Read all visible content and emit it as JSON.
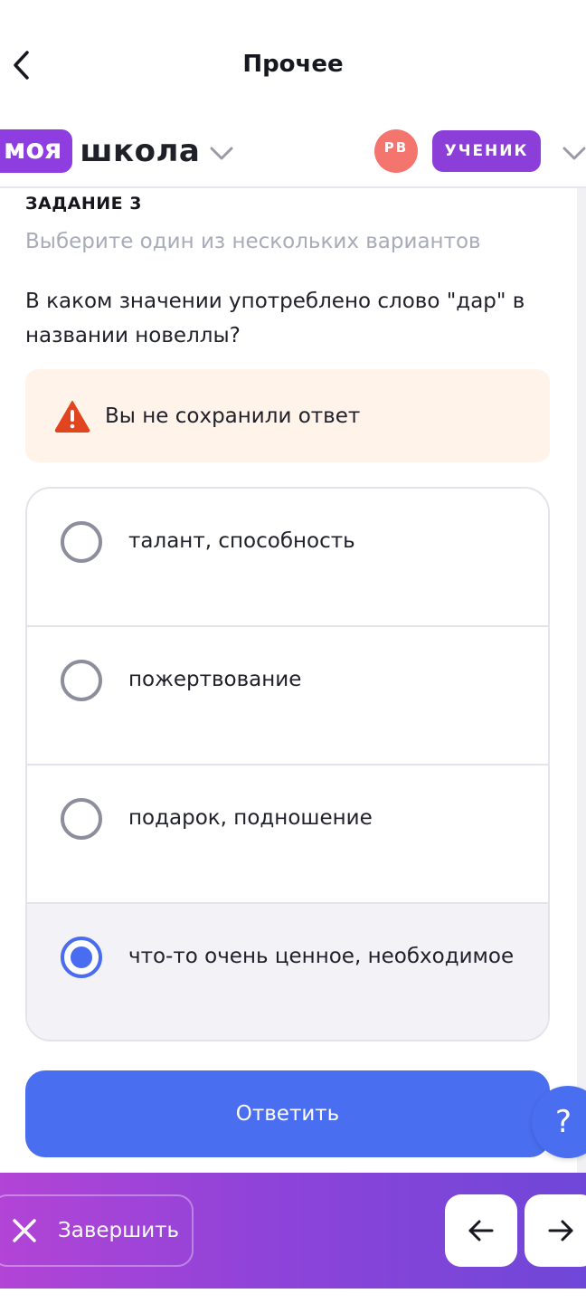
{
  "header": {
    "title": "Прочее",
    "back_icon": "chevron-left-icon"
  },
  "school_bar": {
    "logo_part1": "моя",
    "logo_part2": "школа",
    "avatar_initials": "РВ",
    "role": "УЧЕНИК",
    "colors": {
      "brand": "#8e3ee0",
      "avatar": "#f4746e"
    }
  },
  "task": {
    "label": "ЗАДАНИЕ 3",
    "hint": "Выберите один из нескольких вариантов",
    "question": "В каком значении употреблено слово \"дар\" в названии новеллы?",
    "warning": "Вы не сохранили ответ",
    "options": [
      {
        "text": "талант, способность",
        "selected": false
      },
      {
        "text": "пожертвование",
        "selected": false
      },
      {
        "text": "подарок, подношение",
        "selected": false
      },
      {
        "text": "что-то очень ценное, необходимое",
        "selected": true
      }
    ],
    "submit_label": "Ответить",
    "help_label": "?"
  },
  "bottom_bar": {
    "finish_label": "Завершить",
    "prev_icon": "arrow-left-icon",
    "next_icon": "arrow-right-icon"
  },
  "colors": {
    "primary": "#4a6ef0",
    "warning_bg": "#fff3ea",
    "warning_icon": "#e0451f"
  }
}
